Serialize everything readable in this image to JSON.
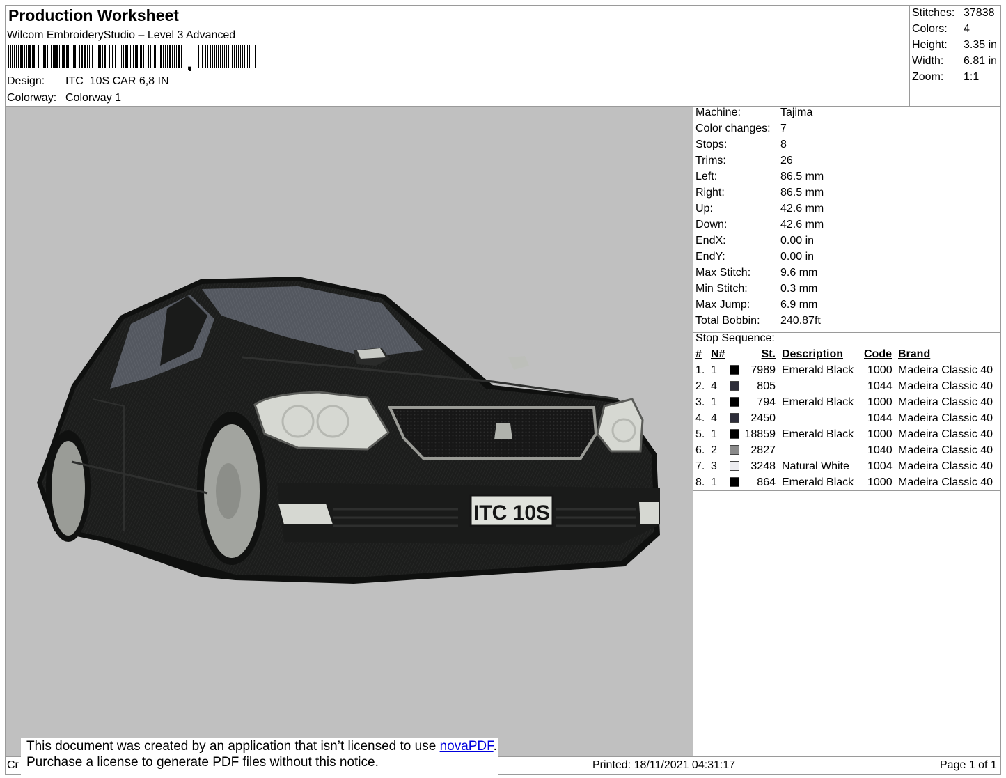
{
  "header": {
    "title": "Production Worksheet",
    "software": "Wilcom EmbroideryStudio – Level 3 Advanced",
    "design_label": "Design:",
    "design_value": "ITC_10S CAR 6,8 IN",
    "colorway_label": "Colorway:",
    "colorway_value": "Colorway 1"
  },
  "summary": [
    {
      "label": "Stitches:",
      "value": "37838"
    },
    {
      "label": "Colors:",
      "value": "4"
    },
    {
      "label": "Height:",
      "value": "3.35 in"
    },
    {
      "label": "Width:",
      "value": "6.81 in"
    },
    {
      "label": "Zoom:",
      "value": "1:1"
    }
  ],
  "specs": [
    {
      "label": "Machine:",
      "value": "Tajima"
    },
    {
      "label": "Color changes:",
      "value": "7"
    },
    {
      "label": "Stops:",
      "value": "8"
    },
    {
      "label": "Trims:",
      "value": "26"
    },
    {
      "label": "Left:",
      "value": "86.5 mm"
    },
    {
      "label": "Right:",
      "value": "86.5 mm"
    },
    {
      "label": "Up:",
      "value": "42.6 mm"
    },
    {
      "label": "Down:",
      "value": "42.6 mm"
    },
    {
      "label": "EndX:",
      "value": "0.00 in"
    },
    {
      "label": "EndY:",
      "value": "0.00 in"
    },
    {
      "label": "Max Stitch:",
      "value": "9.6 mm"
    },
    {
      "label": "Min Stitch:",
      "value": "0.3 mm"
    },
    {
      "label": "Max Jump:",
      "value": "6.9 mm"
    },
    {
      "label": "Total Bobbin:",
      "value": "240.87ft"
    }
  ],
  "stop_sequence": {
    "title": "Stop Sequence:",
    "columns": [
      "#",
      "N#",
      "St.",
      "Description",
      "Code",
      "Brand"
    ],
    "rows": [
      {
        "num": "1.",
        "n": "1",
        "color": "#000000",
        "st": "7989",
        "desc": "Emerald Black",
        "code": "1000",
        "brand": "Madeira Classic 40"
      },
      {
        "num": "2.",
        "n": "4",
        "color": "#2e2e3a",
        "st": "805",
        "desc": "",
        "code": "1044",
        "brand": "Madeira Classic 40"
      },
      {
        "num": "3.",
        "n": "1",
        "color": "#000000",
        "st": "794",
        "desc": "Emerald Black",
        "code": "1000",
        "brand": "Madeira Classic 40"
      },
      {
        "num": "4.",
        "n": "4",
        "color": "#2e2e3a",
        "st": "2450",
        "desc": "",
        "code": "1044",
        "brand": "Madeira Classic 40"
      },
      {
        "num": "5.",
        "n": "1",
        "color": "#000000",
        "st": "18859",
        "desc": "Emerald Black",
        "code": "1000",
        "brand": "Madeira Classic 40"
      },
      {
        "num": "6.",
        "n": "2",
        "color": "#8a8a8a",
        "st": "2827",
        "desc": "",
        "code": "1040",
        "brand": "Madeira Classic 40"
      },
      {
        "num": "7.",
        "n": "3",
        "color": "#ececf0",
        "st": "3248",
        "desc": "Natural White",
        "code": "1004",
        "brand": "Madeira Classic 40"
      },
      {
        "num": "8.",
        "n": "1",
        "color": "#000000",
        "st": "864",
        "desc": "Emerald Black",
        "code": "1000",
        "brand": "Madeira Classic 40"
      }
    ]
  },
  "design_preview": {
    "background_color": "#c0c0c0",
    "plate_text": "ITC 10S"
  },
  "footer": {
    "left_fragment": "Cr",
    "notice_line1": "This document was created by an application that isn’t licensed to use ",
    "notice_link": "novaPDF",
    "notice_period": ".",
    "notice_line2": "Purchase a license to generate PDF files without this notice.",
    "printed": "Printed: 18/11/2021 04:31:17",
    "page": "Page 1 of 1"
  }
}
